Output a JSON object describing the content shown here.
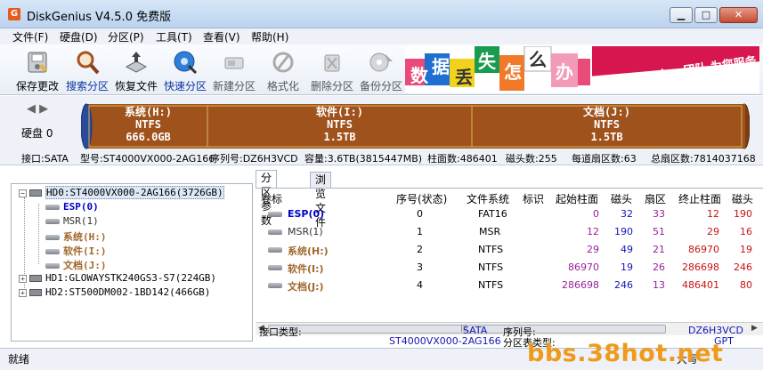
{
  "window": {
    "title": "DiskGenius V4.5.0 免费版",
    "app_icon_glyph": "G",
    "minimize_glyph": "▁",
    "maximize_glyph": "□",
    "close_glyph": "✕"
  },
  "menu": [
    {
      "label": "文件(F)"
    },
    {
      "label": "硬盘(D)"
    },
    {
      "label": "分区(P)"
    },
    {
      "label": "工具(T)"
    },
    {
      "label": "查看(V)"
    },
    {
      "label": "帮助(H)"
    }
  ],
  "toolbar": [
    {
      "label": "保存更改",
      "icon": "save-disk-icon",
      "state": "normal"
    },
    {
      "label": "搜索分区",
      "icon": "magnifier-icon",
      "state": "active"
    },
    {
      "label": "恢复文件",
      "icon": "recover-file-icon",
      "state": "normal"
    },
    {
      "label": "快速分区",
      "icon": "quick-partition-icon",
      "state": "active"
    },
    {
      "label": "新建分区",
      "icon": "new-partition-icon",
      "state": "disabled"
    },
    {
      "label": "格式化",
      "icon": "format-icon",
      "state": "disabled"
    },
    {
      "label": "删除分区",
      "icon": "delete-partition-icon",
      "state": "disabled"
    },
    {
      "label": "备份分区",
      "icon": "backup-partition-icon",
      "state": "disabled"
    }
  ],
  "banner": {
    "text": "DiskGenius 团队 为您服务",
    "chars": [
      "数",
      "据",
      "丢",
      "失",
      "怎",
      "么",
      "办"
    ]
  },
  "diskbar": {
    "nav_left": "◀",
    "nav_right": "▶",
    "disk_label": "硬盘 0",
    "segments": [
      {
        "name": "系统(H:)",
        "fs": "NTFS",
        "size": "666.0GB"
      },
      {
        "name": "软件(I:)",
        "fs": "NTFS",
        "size": "1.5TB"
      },
      {
        "name": "文档(J:)",
        "fs": "NTFS",
        "size": "1.5TB"
      }
    ]
  },
  "disk_info": {
    "interface": "接口:SATA",
    "model": "型号:ST4000VX000-2AG166",
    "serial": "序列号:DZ6H3VCD",
    "capacity": "容量:3.6TB(3815447MB)",
    "cylinders": "柱面数:486401",
    "heads": "磁头数:255",
    "sectors_per_track": "每道扇区数:63",
    "total_sectors": "总扇区数:7814037168"
  },
  "tree": {
    "hd0": "HD0:ST4000VX000-2AG166(3726GB)",
    "hd0_children": [
      {
        "label": "ESP(0)",
        "style": "esp"
      },
      {
        "label": "MSR(1)",
        "style": "msr"
      },
      {
        "label": "系统(H:)",
        "style": "part"
      },
      {
        "label": "软件(I:)",
        "style": "part"
      },
      {
        "label": "文档(J:)",
        "style": "part"
      }
    ],
    "hd1": "HD1:GLOWAYSTK240GS3-S7(224GB)",
    "hd2": "HD2:ST500DM002-1BD142(466GB)",
    "expand_glyph": "+",
    "collapse_glyph": "−"
  },
  "tabs": [
    {
      "label": "分区参数"
    },
    {
      "label": "浏览文件"
    }
  ],
  "table": {
    "headers": [
      "卷标",
      "序号(状态)",
      "文件系统",
      "标识",
      "起始柱面",
      "磁头",
      "扇区",
      "终止柱面",
      "磁头"
    ],
    "rows": [
      {
        "label": "ESP(0)",
        "style": "esp",
        "index": "0",
        "fs": "FAT16",
        "id": "",
        "start_cyl": "0",
        "head": "32",
        "sector": "33",
        "end_cyl": "12",
        "end_head": "190"
      },
      {
        "label": "MSR(1)",
        "style": "msr",
        "index": "1",
        "fs": "MSR",
        "id": "",
        "start_cyl": "12",
        "head": "190",
        "sector": "51",
        "end_cyl": "29",
        "end_head": "16"
      },
      {
        "label": "系统(H:)",
        "style": "part",
        "index": "2",
        "fs": "NTFS",
        "id": "",
        "start_cyl": "29",
        "head": "49",
        "sector": "21",
        "end_cyl": "86970",
        "end_head": "19"
      },
      {
        "label": "软件(I:)",
        "style": "part",
        "index": "3",
        "fs": "NTFS",
        "id": "",
        "start_cyl": "86970",
        "head": "19",
        "sector": "26",
        "end_cyl": "286698",
        "end_head": "246"
      },
      {
        "label": "文档(J:)",
        "style": "part",
        "index": "4",
        "fs": "NTFS",
        "id": "",
        "start_cyl": "286698",
        "head": "246",
        "sector": "13",
        "end_cyl": "486401",
        "end_head": "80"
      }
    ],
    "scroll_left": "◀",
    "scroll_right": "▶",
    "scroll_grip": "|||"
  },
  "details": {
    "interface_label": "接口类型:",
    "interface_value": "SATA",
    "model_value": "ST4000VX000-2AG166",
    "serial_label": "序列号:",
    "serial_value": "DZ6H3VCD",
    "table_type_label": "分区表类型:",
    "table_type_value": "GPT"
  },
  "status": {
    "text": "就绪",
    "right": "大写"
  },
  "watermark": "bbs.38hot.net",
  "colors": {
    "partition_fill": "#a0521c",
    "partition_border": "#d8b65a",
    "esp_text": "#0000cc",
    "part_text": "#a0672a",
    "number_purple": "#9b1f9b",
    "number_blue": "#1414b8",
    "number_red": "#c81414",
    "watermark": "#f09a1a"
  }
}
